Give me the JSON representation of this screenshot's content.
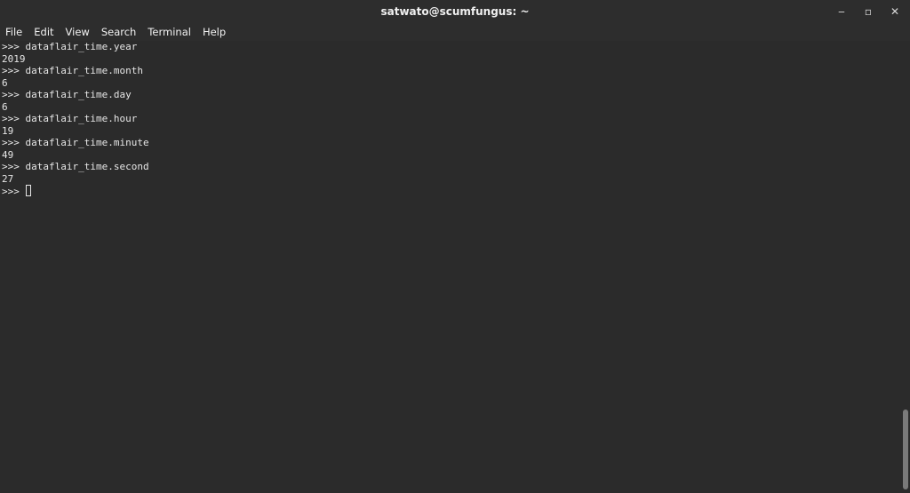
{
  "window": {
    "title": "satwato@scumfungus: ~",
    "controls": {
      "minimize": "‒",
      "maximize": "▫",
      "close": "✕"
    }
  },
  "menu": [
    "File",
    "Edit",
    "View",
    "Search",
    "Terminal",
    "Help"
  ],
  "terminal": {
    "lines": [
      ">>> dataflair_time.year",
      "2019",
      ">>> dataflair_time.month",
      "6",
      ">>> dataflair_time.day",
      "6",
      ">>> dataflair_time.hour",
      "19",
      ">>> dataflair_time.minute",
      "49",
      ">>> dataflair_time.second",
      "27"
    ],
    "prompt": ">>> "
  },
  "scrollbar": {
    "position_fraction": 1.0
  }
}
